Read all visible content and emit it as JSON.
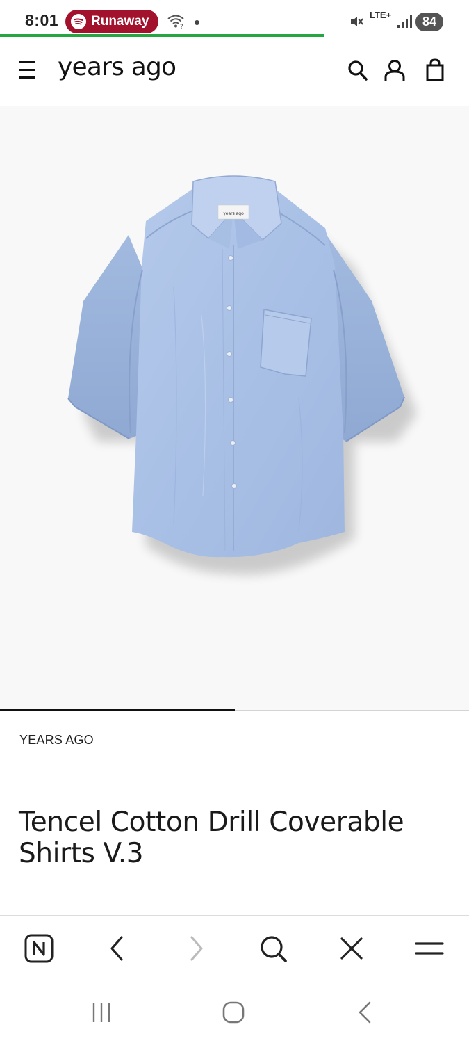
{
  "status_bar": {
    "time": "8:01",
    "media_label": "Runaway",
    "network": "LTE+",
    "battery": "84",
    "accent_color": "#a3122c",
    "load_progress": 0.69
  },
  "header": {
    "logo": "years ago",
    "icons": [
      "menu-icon",
      "search-icon",
      "account-icon",
      "shopping-bag-icon"
    ]
  },
  "product": {
    "image_alt": "Light blue short-sleeve button-up shirt",
    "gallery_progress": 0.5,
    "brand": "YEARS AGO",
    "title": "Tencel Cotton Drill Coverable Shirts V.3",
    "shirt_tag": "years ago"
  },
  "browser_toolbar": {
    "buttons": [
      "home-n-icon",
      "back-icon",
      "forward-icon",
      "search-icon",
      "close-icon",
      "menu-icon"
    ]
  },
  "system_nav": {
    "buttons": [
      "recent-apps-icon",
      "home-icon",
      "back-icon"
    ]
  }
}
